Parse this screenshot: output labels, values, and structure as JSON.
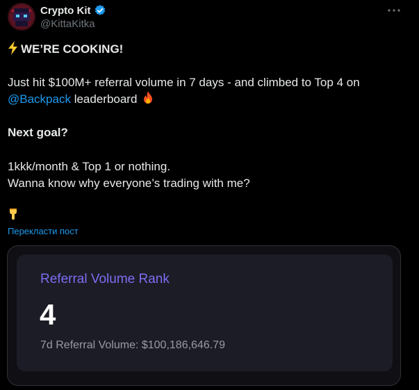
{
  "author": {
    "display_name": "Crypto Kit",
    "handle": "@KittaKitka",
    "verified": true,
    "avatar_icon": "pixel-ninja-avatar"
  },
  "tweet": {
    "line1": "WE’RE COOKING!",
    "line1_icon": "lightning-icon",
    "line2": "Just hit $100M+ referral volume in 7 days - and climbed to Top 4 on",
    "line3_mention": "@Backpack",
    "line3_rest": " leaderboard",
    "line3_icon": "fire-icon",
    "line4": "Next goal?",
    "line5": " 1kkk/month & Top 1 or nothing.",
    "line6": "Wanna know why everyone’s trading with me?",
    "line7_icon": "point-down-icon",
    "translate_label": "Перекласти пост"
  },
  "card": {
    "title": "Referral Volume Rank",
    "rank": "4",
    "volume_text": "7d Referral Volume: $100,186,646.79"
  },
  "colors": {
    "background": "#000000",
    "link": "#1d9bf0",
    "card_title": "#7c6df2",
    "verified": "#1d9bf0"
  }
}
